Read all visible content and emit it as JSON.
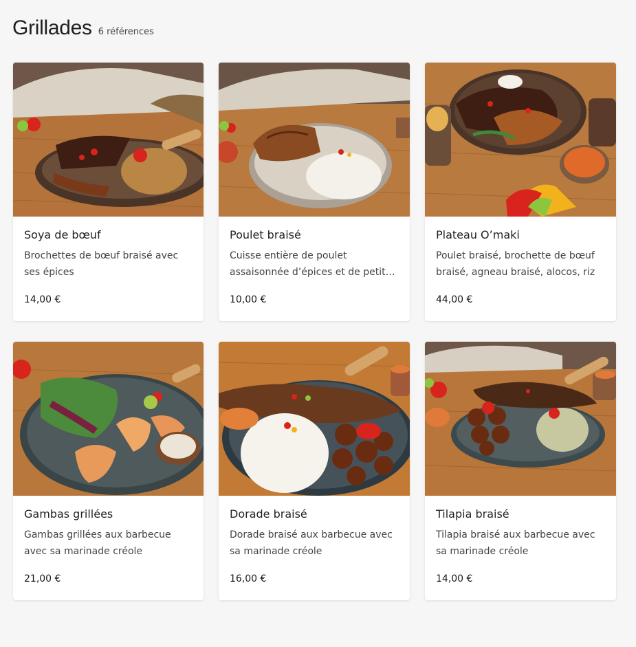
{
  "header": {
    "title": "Grillades",
    "count": "6 références"
  },
  "products": [
    {
      "name": "Soya de bœuf",
      "description": "Brochettes de bœuf braisé avec ses épices",
      "price": "14,00 €",
      "image_icon": "beef-skewers-plate-image"
    },
    {
      "name": "Poulet braisé",
      "description": "Cuisse entière de poulet assaisonnée d’épices et de petits légumes",
      "price": "10,00 €",
      "image_icon": "grilled-chicken-plate-image"
    },
    {
      "name": "Plateau O’maki",
      "description": "Poulet braisé, brochette de bœuf braisé, agneau braisé, alocos, riz",
      "price": "44,00 €",
      "image_icon": "mixed-grill-platter-image"
    },
    {
      "name": "Gambas grillées",
      "description": "Gambas grillées aux barbecue avec sa marinade créole",
      "price": "21,00 €",
      "image_icon": "grilled-prawns-plate-image"
    },
    {
      "name": "Dorade braisé",
      "description": "Dorade braisé aux barbecue avec sa marinade créole",
      "price": "16,00 €",
      "image_icon": "grilled-sea-bream-plate-image"
    },
    {
      "name": "Tilapia braisé",
      "description": "Tilapia braisé aux barbecue avec sa marinade créole",
      "price": "14,00 €",
      "image_icon": "grilled-tilapia-plate-image"
    }
  ],
  "colors": {
    "background": "#f6f6f6",
    "card": "#ffffff",
    "wood": "#b8763a",
    "plate_dark": "#5a4a3e",
    "plate_light": "#d8d0c2",
    "tomato": "#d8241c",
    "rice": "#f4f1ea",
    "meat": "#5b2a14"
  }
}
